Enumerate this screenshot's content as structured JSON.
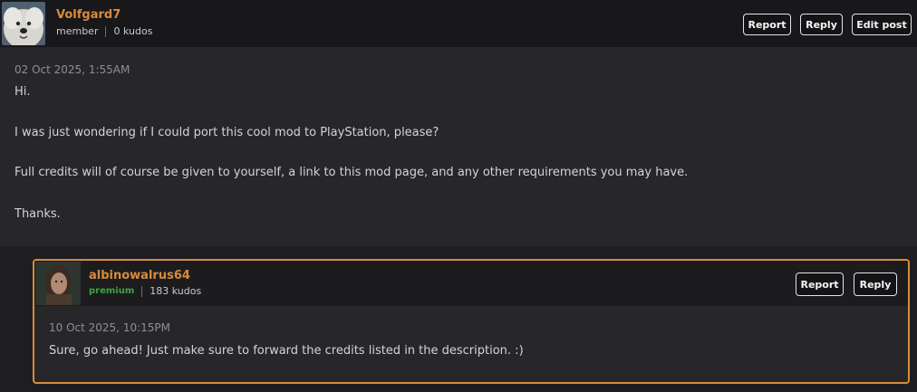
{
  "post": {
    "username": "Volfgard7",
    "role": "member",
    "kudos": "0 kudos",
    "timestamp": "02 Oct 2025, 1:55AM",
    "actions": {
      "report": "Report",
      "reply": "Reply",
      "edit": "Edit post"
    },
    "body": [
      "Hi.",
      "I was just wondering if I could port this cool mod to PlayStation, please?",
      "Full credits will of course be given to yourself, a link to this mod page, and any other requirements you may have.",
      "Thanks."
    ]
  },
  "reply": {
    "username": "albinowalrus64",
    "role": "premium",
    "kudos": "183 kudos",
    "timestamp": "10 Oct 2025, 10:15PM",
    "actions": {
      "report": "Report",
      "reply": "Reply"
    },
    "body": "Sure, go ahead! Just make sure to forward the credits listed in the description. :)"
  },
  "colors": {
    "accent": "#d98b3a",
    "premium": "#3fa43f"
  }
}
